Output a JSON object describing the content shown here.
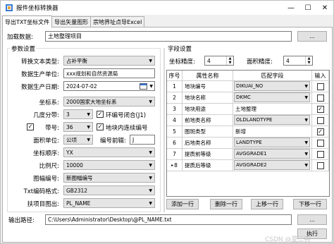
{
  "window": {
    "title": "报件坐标转换器",
    "min": "—",
    "max": "☐",
    "close": "✕"
  },
  "tabs": [
    {
      "label": "导出TXT坐标文件"
    },
    {
      "label": "导出矢量图形"
    },
    {
      "label": "宗地界址点导Excel"
    }
  ],
  "load": {
    "label": "加载数据:",
    "value": "土地整理项目"
  },
  "params": {
    "title": "参数设置",
    "convert_type": {
      "label": "转换文本类型:",
      "value": "占补平衡"
    },
    "producer": {
      "label": "数据生产单位:",
      "value": "xxx规划和自然资源局"
    },
    "date": {
      "label": "数据生产日期:",
      "value": "2024-07-02"
    },
    "crs": {
      "label": "坐标系:",
      "value": "2000国家大地坐标系"
    },
    "zone_method": {
      "label": "几度分带:",
      "value": "3"
    },
    "ring_check": {
      "label": "环编号闭合(J1)",
      "checked": true
    },
    "zone_no": {
      "label": "带号:",
      "value": "36",
      "checked": true
    },
    "continuous": {
      "label": "地块内连续编号",
      "checked": true
    },
    "area_unit": {
      "label": "面积单位:",
      "value": "公顷"
    },
    "prefix": {
      "label": "编号前辍:",
      "value": "J"
    },
    "coord_order": {
      "label": "坐标顺序:",
      "value": "YX"
    },
    "scale": {
      "label": "比例尺:",
      "value": "10000"
    },
    "sheet_no": {
      "label": "图幅编号:",
      "value": "新图幅编号"
    },
    "encoding": {
      "label": "Txt编码格式:",
      "value": "GB2312"
    },
    "extended": {
      "label": "扶项目图出:",
      "value": "PL_NAME"
    }
  },
  "fields": {
    "title": "字段设置",
    "precision": {
      "label": "坐标精度:",
      "value": "4"
    },
    "area_precision": {
      "label": "面积精度:",
      "value": "4"
    },
    "headers": [
      "序号",
      "属性名称",
      "匹配字段",
      "输入"
    ],
    "rows": [
      {
        "no": "1",
        "name": "地块编号",
        "field": "DIKUAI_NO",
        "type": "combo",
        "checked": false
      },
      {
        "no": "2",
        "name": "地块名称",
        "field": "DKMC",
        "type": "combo",
        "checked": false
      },
      {
        "no": "3",
        "name": "地块用途",
        "field": "土地整理",
        "type": "text",
        "checked": true
      },
      {
        "no": "4",
        "name": "前地类名称",
        "field": "OLDLANDTYPE",
        "type": "combo",
        "checked": false
      },
      {
        "no": "5",
        "name": "图斑类型",
        "field": "新增",
        "type": "text",
        "checked": true
      },
      {
        "no": "6",
        "name": "后地类名称",
        "field": "LANDTYPE",
        "type": "combo",
        "checked": false
      },
      {
        "no": "7",
        "name": "提质前等级",
        "field": "AVGGRADE1",
        "type": "combo",
        "checked": false
      },
      {
        "no": "8",
        "name": "提质后等级",
        "field": "AVGGRADE2",
        "type": "combo",
        "checked": false,
        "current": true
      }
    ],
    "row_marker": "▸",
    "buttons": {
      "add": "添加一行",
      "delete": "删除一行",
      "up": "上移一行",
      "down": "下移一行"
    }
  },
  "output": {
    "label": "输出路径:",
    "value": "C:\\Users\\Administrator\\Desktop\\@PL_NAME.txt",
    "browse": "...",
    "execute": "执行"
  },
  "load_browse": "...",
  "watermark": "CSDN @夏三狗",
  "icons": {
    "app": "app-icon",
    "calendar": "calendar-icon",
    "dropdown": "chevron-down-icon"
  }
}
